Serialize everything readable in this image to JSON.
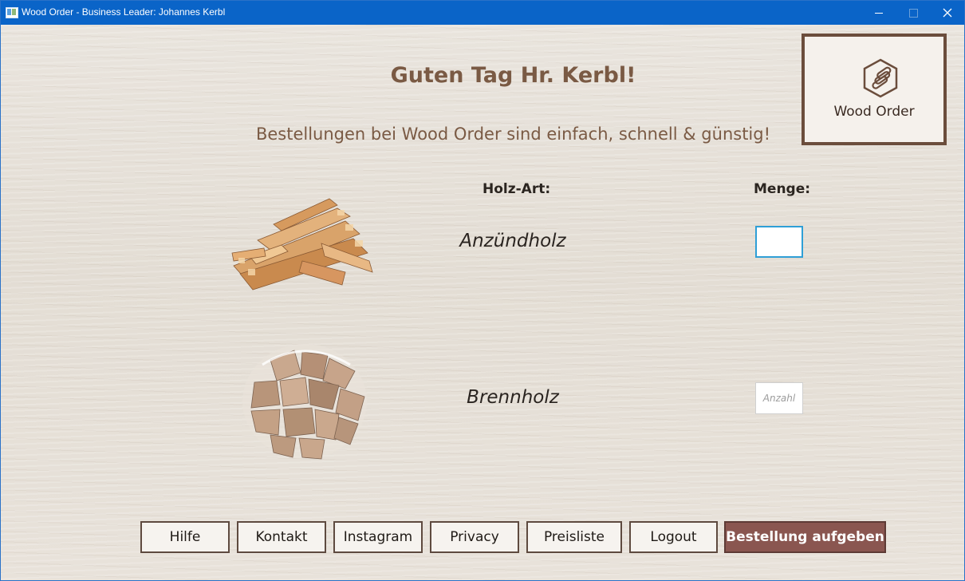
{
  "window": {
    "title": "Wood Order - Business Leader: Johannes Kerbl",
    "controls": {
      "minimize": "—",
      "maximize": "□",
      "close": "✕"
    }
  },
  "header": {
    "greeting": "Guten Tag Hr. Kerbl!",
    "tagline": "Bestellungen bei Wood Order sind einfach, schnell & günstig!"
  },
  "logo": {
    "text": "Wood Order",
    "icon": "logs-hexagon-icon"
  },
  "columns": {
    "wood_type": "Holz-Art:",
    "quantity": "Menge:"
  },
  "items": [
    {
      "name": "Anzündholz",
      "image": "kindling-pile-image",
      "quantity_value": "",
      "quantity_placeholder": ""
    },
    {
      "name": "Brennholz",
      "image": "firewood-bundle-image",
      "quantity_value": "",
      "quantity_placeholder": "Anzahl"
    }
  ],
  "buttons": {
    "help": "Hilfe",
    "contact": "Kontakt",
    "instagram": "Instagram",
    "privacy": "Privacy",
    "pricelist": "Preisliste",
    "logout": "Logout",
    "order": "Bestellung aufgeben"
  },
  "colors": {
    "titlebar": "#0a64c8",
    "heading": "#7a5a44",
    "order_button": "#8a5650",
    "button_border": "#5e4a3f",
    "focus_border": "#2f9fd6"
  }
}
